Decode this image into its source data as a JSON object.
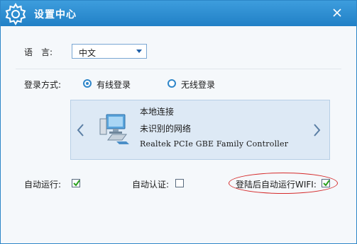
{
  "window": {
    "title": "设置中心",
    "icons": {
      "app": "gear-icon",
      "close": "close-icon"
    },
    "colors": {
      "titlebar": "#2180c6",
      "accent": "#2f86c9",
      "highlight": "#d52a2a"
    }
  },
  "language": {
    "label": "语　言:",
    "selected": "中文",
    "icon": "dropdown-arrow-icon"
  },
  "login": {
    "label": "登录方式:",
    "options": [
      {
        "label": "有线登录",
        "checked": true
      },
      {
        "label": "无线登录",
        "checked": false
      }
    ]
  },
  "adapter": {
    "name": "本地连接",
    "status": "未识别的网络",
    "device": "Realtek PCIe GBE Family Controller",
    "icons": {
      "prev": "chevron-left-icon",
      "next": "chevron-right-icon",
      "device": "network-computer-icon"
    }
  },
  "options": {
    "autorun": {
      "label": "自动运行:",
      "checked": true
    },
    "autoauth": {
      "label": "自动认证:",
      "checked": false
    },
    "wifi_autorun": {
      "label": "登陆后自动运行WIFI:",
      "checked": true
    }
  }
}
